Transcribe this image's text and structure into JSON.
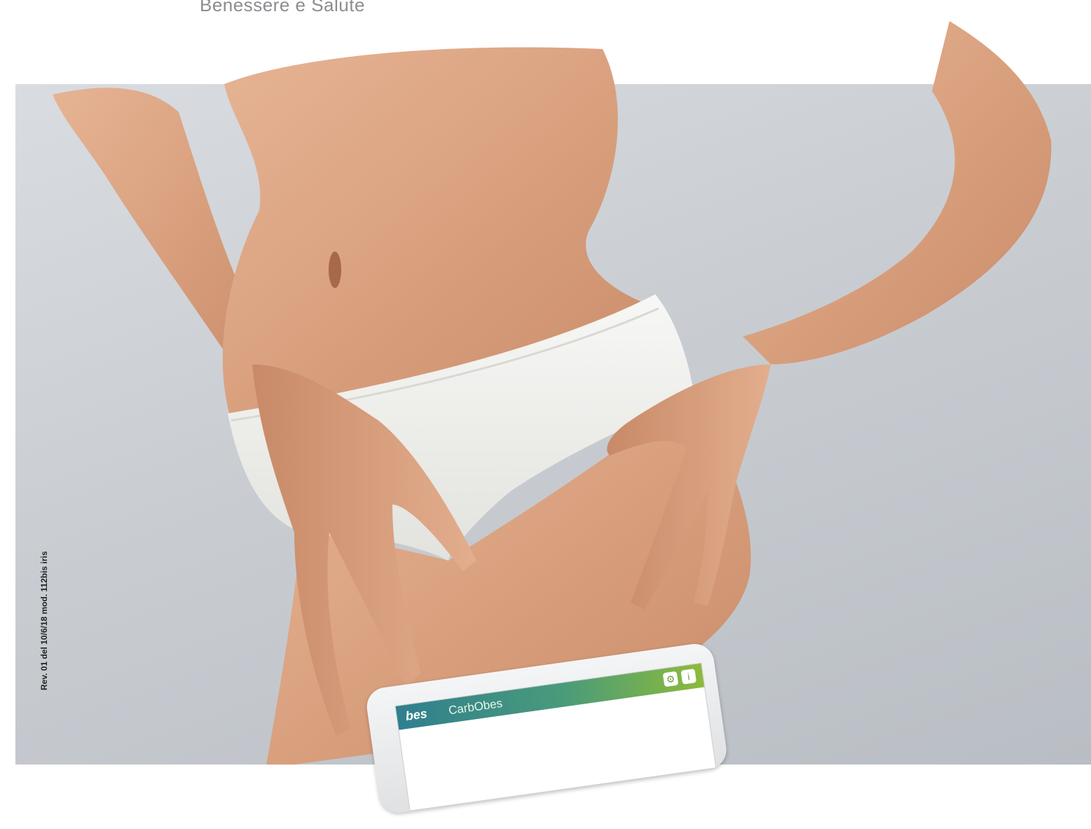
{
  "header": {
    "subtitle": "Benessere e Salute"
  },
  "side_code": "Rev. 01 del 10/6/18 mod. 112bis iris",
  "device": {
    "brand": "bes",
    "product": "CarbObes",
    "icons": [
      "gear-icon",
      "info-icon"
    ]
  },
  "colors": {
    "background": "#c9cdd2",
    "accent_green": "#8dbb3a",
    "accent_teal": "#2f7f8f"
  }
}
